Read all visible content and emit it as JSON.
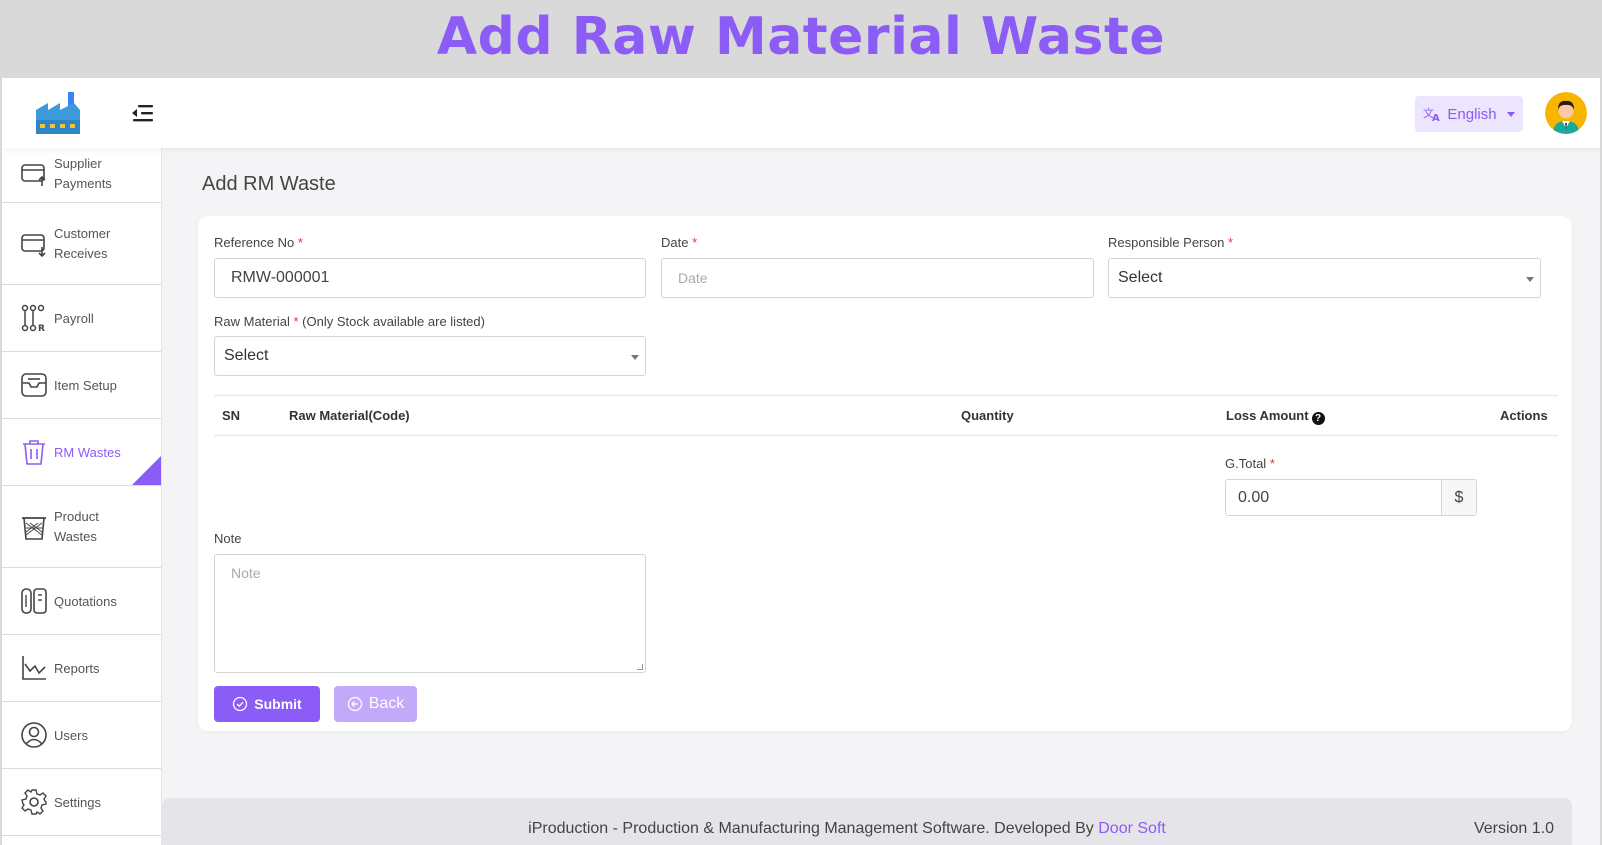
{
  "banner": {
    "title": "Add Raw Material Waste"
  },
  "header": {
    "language": "English",
    "colors": {
      "accent": "#8b5cf6",
      "accent_light": "#ede5fd"
    }
  },
  "sidebar": {
    "items": [
      {
        "label_lines": [
          "Supplier",
          "Payments"
        ],
        "icon": "supplier-payments-icon"
      },
      {
        "label_lines": [
          "Customer",
          "Receives"
        ],
        "icon": "customer-receives-icon"
      },
      {
        "label_lines": [
          "Payroll"
        ],
        "icon": "payroll-icon"
      },
      {
        "label_lines": [
          "Item Setup"
        ],
        "icon": "item-setup-icon"
      },
      {
        "label_lines": [
          "RM Wastes"
        ],
        "icon": "trash-icon",
        "active": true
      },
      {
        "label_lines": [
          "Product",
          "Wastes"
        ],
        "icon": "waste-basket-icon"
      },
      {
        "label_lines": [
          "Quotations"
        ],
        "icon": "quotations-icon"
      },
      {
        "label_lines": [
          "Reports"
        ],
        "icon": "chart-icon"
      },
      {
        "label_lines": [
          "Users"
        ],
        "icon": "user-icon"
      },
      {
        "label_lines": [
          "Settings"
        ],
        "icon": "gear-icon"
      }
    ]
  },
  "page": {
    "title": "Add RM Waste"
  },
  "form": {
    "reference_no": {
      "label": "Reference No",
      "required": "*",
      "value": "RMW-000001"
    },
    "date": {
      "label": "Date",
      "required": "*",
      "placeholder": "Date"
    },
    "responsible_person": {
      "label": "Responsible Person",
      "required": "*",
      "value": "Select"
    },
    "raw_material": {
      "label": "Raw Material",
      "required": "*",
      "hint": "(Only Stock available are listed)",
      "value": "Select"
    },
    "table": {
      "columns": [
        "SN",
        "Raw Material(Code)",
        "Quantity",
        "Loss Amount",
        "Actions"
      ],
      "help_icon": "?"
    },
    "g_total": {
      "label": "G.Total",
      "required": "*",
      "value": "0.00",
      "currency": "$"
    },
    "note": {
      "label": "Note",
      "placeholder": "Note"
    },
    "buttons": {
      "submit": "Submit",
      "back": "Back"
    }
  },
  "footer": {
    "text": "iProduction - Production & Manufacturing Management Software. Developed By",
    "link": "Door Soft",
    "version": "Version 1.0"
  }
}
